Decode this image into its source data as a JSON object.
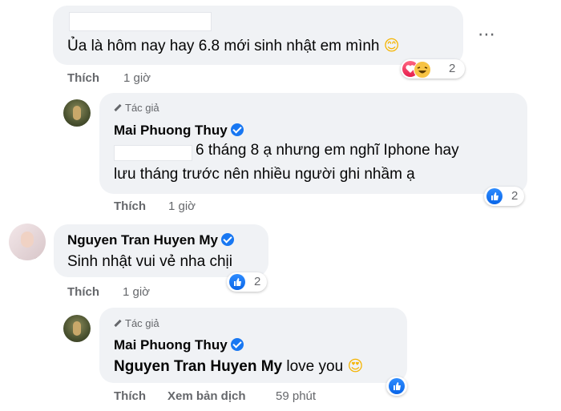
{
  "comment1": {
    "text": "Ủa là hôm nay hay 6.8 mới sinh nhật em mình",
    "emoji": "😊",
    "reaction_count": "2",
    "like_label": "Thích",
    "time": "1 giờ",
    "more_icon": "⋯"
  },
  "reply1": {
    "author_badge": "Tác giả",
    "name": "Mai Phuong Thuy",
    "line1": "6 tháng 8 ạ nhưng em nghĩ Iphone hay",
    "line2": "lưu tháng trước nên nhiều người ghi nhầm ạ",
    "reaction_count": "2",
    "like_label": "Thích",
    "time": "1 giờ"
  },
  "comment2": {
    "name": "Nguyen Tran Huyen My",
    "text": "Sinh nhật vui vẻ nha chịi",
    "reaction_count": "2",
    "like_label": "Thích",
    "time": "1 giờ"
  },
  "reply2": {
    "author_badge": "Tác giả",
    "name": "Mai Phuong Thuy",
    "mention": "Nguyen Tran Huyen My",
    "text": " love you",
    "emoji": "😍",
    "like_label": "Thích",
    "translate_label": "Xem bản dịch",
    "time": "59 phút"
  },
  "colors": {
    "bubble": "#f0f2f5",
    "accent": "#1877f2",
    "secondary_text": "#65676b"
  },
  "icons": {
    "verified": "verified-badge-icon",
    "like": "like-reaction-icon",
    "love": "heart-reaction-icon",
    "haha": "haha-reaction-icon",
    "pen": "pen-icon"
  }
}
